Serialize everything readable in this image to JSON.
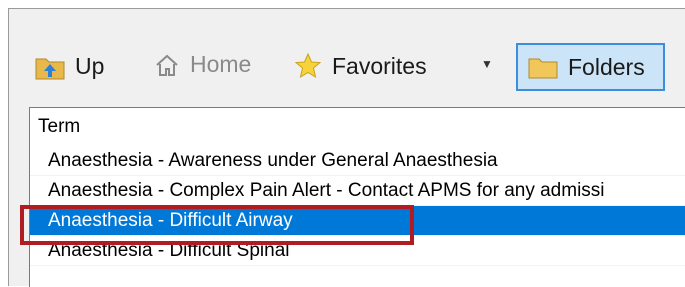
{
  "toolbar": {
    "up_label": "Up",
    "home_label": "Home",
    "favorites_label": "Favorites",
    "dropdown_glyph": "▼",
    "folders_label": "Folders"
  },
  "icons": {
    "up": "folder-up-icon",
    "home": "home-icon",
    "favorites": "star-icon",
    "folders": "folder-icon"
  },
  "list": {
    "column_header": "Term",
    "rows": [
      {
        "label": "Anaesthesia - Awareness under General Anaesthesia",
        "selected": false
      },
      {
        "label": "Anaesthesia - Complex Pain Alert - Contact APMS for any admissi",
        "selected": false
      },
      {
        "label": "Anaesthesia - Difficult Airway",
        "selected": true
      },
      {
        "label": "Anaesthesia - Difficult Spinal",
        "selected": false
      }
    ]
  },
  "colors": {
    "selection": "#0078d7",
    "highlight_box": "#b01c22",
    "folders_button_bg": "#cce4f7"
  }
}
